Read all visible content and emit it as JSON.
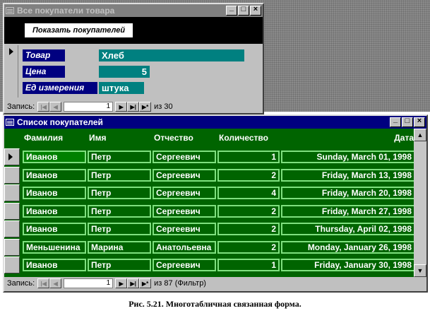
{
  "top_window": {
    "title": "Все покупатели товара",
    "show_button": "Показать покупателей",
    "fields": [
      {
        "label": "Товар",
        "value": "Хлеб"
      },
      {
        "label": "Цена",
        "value": "5"
      },
      {
        "label": "Ед измерения",
        "value": "штука"
      }
    ],
    "nav": {
      "label": "Запись:",
      "current": "1",
      "of_text": "из 30"
    }
  },
  "list_window": {
    "title": "Список покупателей",
    "columns": [
      "Фамилия",
      "Имя",
      "Отчество",
      "Количество",
      "Дата"
    ],
    "rows": [
      {
        "surname": "Иванов",
        "name": "Петр",
        "patronymic": "Сергеевич",
        "qty": "1",
        "date": "Sunday, March 01, 1998"
      },
      {
        "surname": "Иванов",
        "name": "Петр",
        "patronymic": "Сергеевич",
        "qty": "2",
        "date": "Friday, March 13, 1998"
      },
      {
        "surname": "Иванов",
        "name": "Петр",
        "patronymic": "Сергеевич",
        "qty": "4",
        "date": "Friday, March 20, 1998"
      },
      {
        "surname": "Иванов",
        "name": "Петр",
        "patronymic": "Сергеевич",
        "qty": "2",
        "date": "Friday, March 27, 1998"
      },
      {
        "surname": "Иванов",
        "name": "Петр",
        "patronymic": "Сергеевич",
        "qty": "2",
        "date": "Thursday, April 02, 1998"
      },
      {
        "surname": "Меньшенина",
        "name": "Марина",
        "patronymic": "Анатольевна",
        "qty": "2",
        "date": "Monday, January 26, 1998"
      },
      {
        "surname": "Иванов",
        "name": "Петр",
        "patronymic": "Сергеевич",
        "qty": "1",
        "date": "Friday, January 30, 1998"
      }
    ],
    "nav": {
      "label": "Запись:",
      "current": "1",
      "of_text": "из 87 (Фильтр)"
    }
  },
  "caption": "Рис. 5.21. Многотабличная связанная форма.",
  "colors": {
    "title_active": "#000080",
    "title_inactive": "#808080",
    "field_label": "#000080",
    "field_value": "#008080",
    "list_bg": "#006400",
    "cell_border": "#7fe07f"
  }
}
